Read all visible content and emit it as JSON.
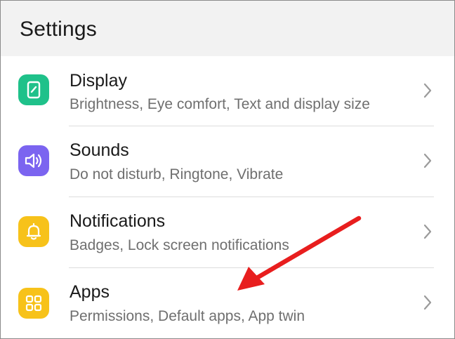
{
  "header": {
    "title": "Settings"
  },
  "items": [
    {
      "label": "Display",
      "subtitle": "Brightness, Eye comfort, Text and display size",
      "icon": "display-icon",
      "color": "#1fc18a"
    },
    {
      "label": "Sounds",
      "subtitle": "Do not disturb, Ringtone, Vibrate",
      "icon": "speaker-icon",
      "color": "#7b64f0"
    },
    {
      "label": "Notifications",
      "subtitle": "Badges, Lock screen notifications",
      "icon": "bell-icon",
      "color": "#f7c21a"
    },
    {
      "label": "Apps",
      "subtitle": "Permissions, Default apps, App twin",
      "icon": "apps-grid-icon",
      "color": "#f7c21a"
    }
  ],
  "annotation": {
    "type": "red-arrow",
    "color": "#e81e1e",
    "points_to": "Apps"
  }
}
